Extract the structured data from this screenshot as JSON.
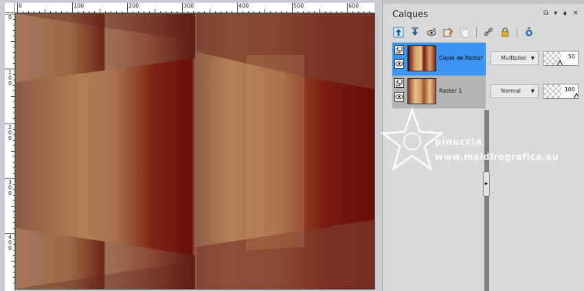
{
  "ruler": {
    "top_labels": [
      "0",
      "100",
      "200",
      "300",
      "400",
      "500",
      "600"
    ],
    "left_labels": [
      [
        "0"
      ],
      [
        "1",
        "0",
        "0"
      ],
      [
        "2",
        "0",
        "0"
      ],
      [
        "3",
        "0",
        "0"
      ],
      [
        "4",
        "0",
        "0"
      ]
    ]
  },
  "palette": {
    "title": "Calques",
    "title_buttons": [
      "restore-icon",
      "menu-arrow-icon",
      "pin-icon",
      "close-icon"
    ],
    "toolbar": [
      "move-layer-up-icon",
      "move-layer-down-icon",
      "visibility-toggle-icon",
      "properties-icon",
      "duplicate-layer-icon",
      "link-icon",
      "lock-icon",
      "mask-icon"
    ]
  },
  "layers": [
    {
      "name": "Copie de Raster",
      "blend_mode": "Multiplier",
      "opacity": "50",
      "selected": true
    },
    {
      "name": "Raster 1",
      "blend_mode": "Normal",
      "opacity": "100",
      "selected": false
    }
  ],
  "watermark": {
    "line1": "pinuccia",
    "line2": "www.maidiregrafica.eu"
  },
  "colors": {
    "selected_layer": "#3a95f5",
    "dark_red": "#6b0e0a",
    "tan": "#b08050"
  }
}
